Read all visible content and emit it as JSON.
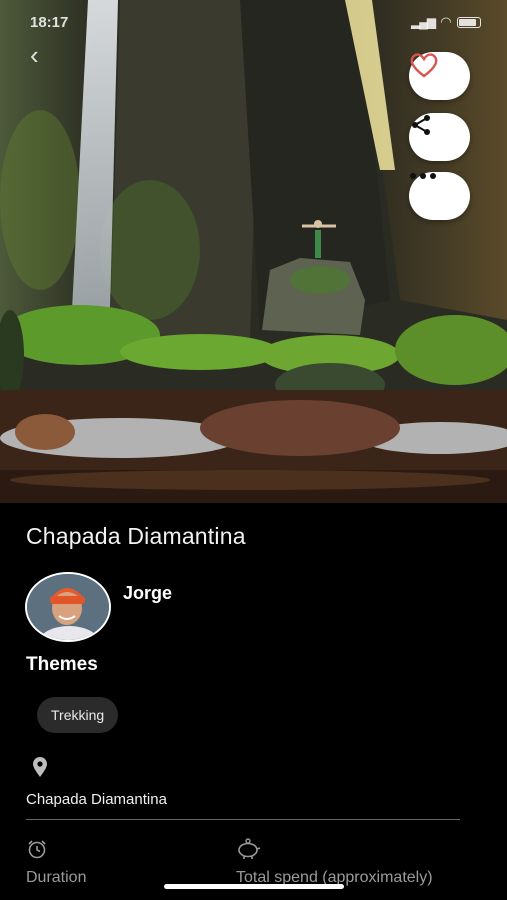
{
  "status_bar": {
    "time": "18:17"
  },
  "place": {
    "title": "Chapada Diamantina"
  },
  "author": {
    "name": "Jorge"
  },
  "themes": {
    "heading": "Themes",
    "tags": [
      "Trekking"
    ]
  },
  "location": {
    "label": "Chapada Diamantina"
  },
  "stats": {
    "duration_label": "Duration",
    "spend_label": "Total spend (approximately)"
  },
  "colors": {
    "heart": "#d9534f",
    "background": "#000000",
    "chip": "#2b2b2b"
  },
  "icons": [
    "back-arrow-icon",
    "heart-icon",
    "share-icon",
    "more-icon",
    "pin-icon",
    "alarm-clock-icon",
    "piggy-bank-icon"
  ]
}
